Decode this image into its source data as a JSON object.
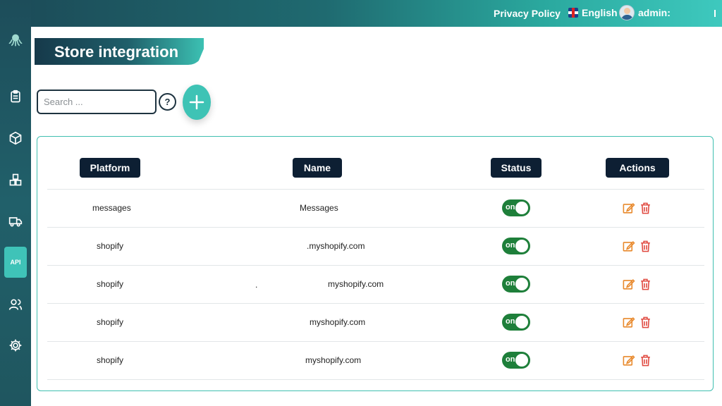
{
  "header": {
    "privacy_label": "Privacy Policy",
    "language_label": "English",
    "user_label": "admin:"
  },
  "sidebar": {
    "items": [
      {
        "name": "octopus-logo-icon"
      },
      {
        "name": "clipboard-icon"
      },
      {
        "name": "box-icon"
      },
      {
        "name": "cubes-icon"
      },
      {
        "name": "truck-icon"
      },
      {
        "name": "api",
        "label": "API",
        "active": true
      },
      {
        "name": "users-icon"
      },
      {
        "name": "gear-icon"
      }
    ]
  },
  "page": {
    "title": "Store integration",
    "search_placeholder": "Search ...",
    "help_label": "?"
  },
  "table": {
    "columns": [
      "Platform",
      "Name",
      "Status",
      "Actions"
    ],
    "rows": [
      {
        "platform": "messages",
        "name": "Messages",
        "status": "on"
      },
      {
        "platform": "shopify",
        "name": ".myshopify.com",
        "status": "on"
      },
      {
        "platform": "shopify",
        "name": "myshopify.com",
        "name_prefix": ".",
        "status": "on"
      },
      {
        "platform": "shopify",
        "name": "myshopify.com",
        "status": "on"
      },
      {
        "platform": "shopify",
        "name": "myshopify.com",
        "status": "on"
      }
    ]
  },
  "colors": {
    "accent": "#3ec3b5",
    "header_dark": "#0d1f33",
    "toggle_on": "#1e7f3a",
    "edit_icon": "#e8892c",
    "delete_icon": "#e0483f"
  }
}
